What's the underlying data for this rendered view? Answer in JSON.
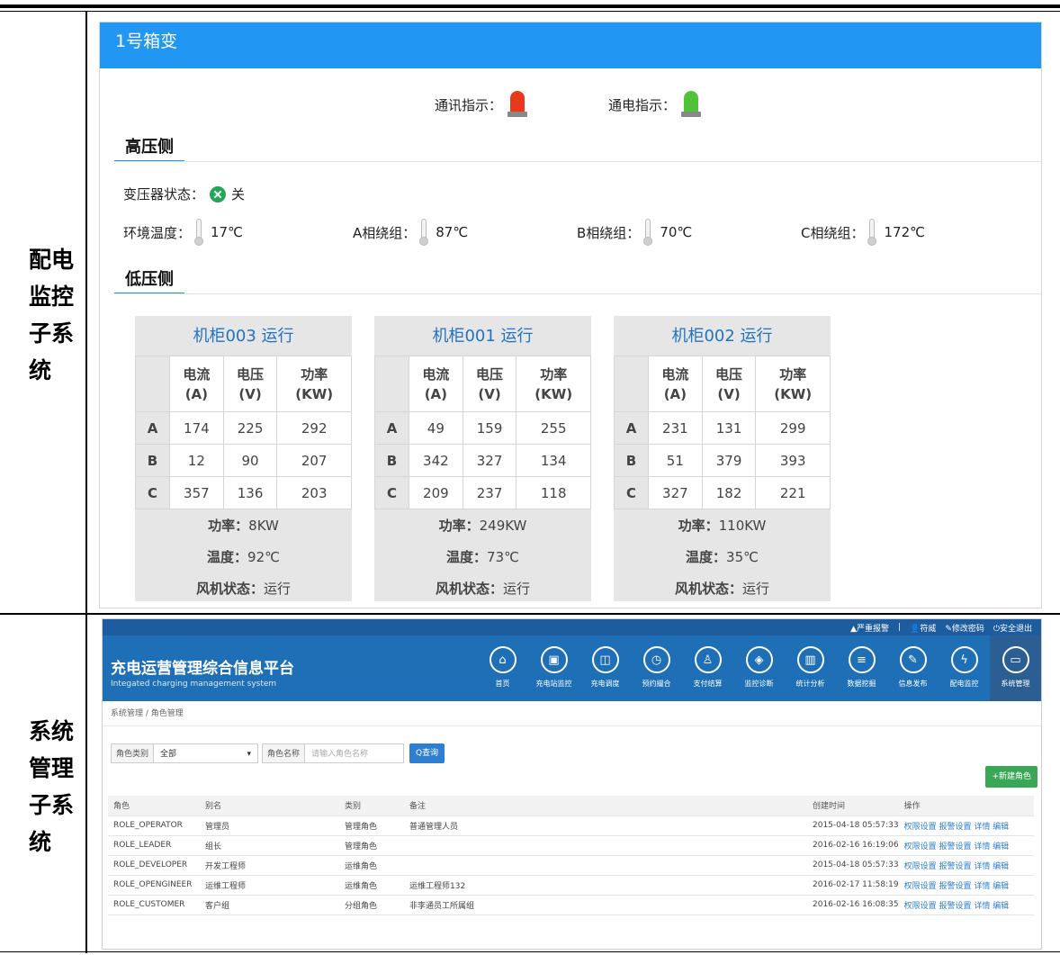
{
  "rows": [
    {
      "label": "配电监控子系统"
    },
    {
      "label": "系统管理子系统"
    }
  ],
  "monitor": {
    "title": "1号箱变",
    "comm_label": "通讯指示：",
    "power_label": "通电指示：",
    "high_side": "高压侧",
    "low_side": "低压侧",
    "transformer_label": "变压器状态：",
    "transformer_state": "关",
    "env_temp_label": "环境温度：",
    "env_temp": "17℃",
    "a_label": "A相绕组：",
    "a_temp": "87℃",
    "b_label": "B相绕组：",
    "b_temp": "70℃",
    "c_label": "C相绕组：",
    "c_temp": "172℃",
    "col_current": "电流",
    "col_current_unit": "(A)",
    "col_voltage": "电压",
    "col_voltage_unit": "(V)",
    "col_power": "功率",
    "col_power_unit": "(KW)",
    "power_prefix": "功率：",
    "temp_prefix": "温度：",
    "fan_prefix": "风机状态：",
    "colors": {
      "header": "#2196f3",
      "comm_lamp": "#e8391c",
      "power_lamp": "#4fc23a"
    },
    "cabinets": [
      {
        "name": "机柜003",
        "state": "运行",
        "rows": [
          [
            "A",
            "174",
            "225",
            "292"
          ],
          [
            "B",
            "12",
            "90",
            "207"
          ],
          [
            "C",
            "357",
            "136",
            "203"
          ]
        ],
        "power": "8KW",
        "temp": "92℃",
        "fan": "运行"
      },
      {
        "name": "机柜001",
        "state": "运行",
        "rows": [
          [
            "A",
            "49",
            "159",
            "255"
          ],
          [
            "B",
            "342",
            "327",
            "134"
          ],
          [
            "C",
            "209",
            "237",
            "118"
          ]
        ],
        "power": "249KW",
        "temp": "73℃",
        "fan": "运行"
      },
      {
        "name": "机柜002",
        "state": "运行",
        "rows": [
          [
            "A",
            "231",
            "131",
            "299"
          ],
          [
            "B",
            "51",
            "379",
            "393"
          ],
          [
            "C",
            "327",
            "182",
            "221"
          ]
        ],
        "power": "110KW",
        "temp": "35℃",
        "fan": "运行"
      }
    ]
  },
  "admin": {
    "topbar": [
      "▲严重报警",
      "|",
      "👤符威",
      "✎修改密码",
      "⏻安全退出"
    ],
    "brand_title": "充电运营管理综合信息平台",
    "brand_sub": "Integated charging management system",
    "nav": [
      {
        "icon": "⌂",
        "label": "首页",
        "icon_name": "home-icon"
      },
      {
        "icon": "▣",
        "label": "充电站监控",
        "icon_name": "station-icon"
      },
      {
        "icon": "◫",
        "label": "充电调度",
        "icon_name": "dispatch-icon"
      },
      {
        "icon": "◷",
        "label": "预约撮合",
        "icon_name": "clock-icon"
      },
      {
        "icon": "♙",
        "label": "支付结算",
        "icon_name": "money-icon"
      },
      {
        "icon": "◈",
        "label": "监控诊断",
        "icon_name": "diagnose-icon"
      },
      {
        "icon": "▥",
        "label": "统计分析",
        "icon_name": "chart-icon"
      },
      {
        "icon": "≡",
        "label": "数据挖掘",
        "icon_name": "list-icon"
      },
      {
        "icon": "✎",
        "label": "信息发布",
        "icon_name": "edit-icon"
      },
      {
        "icon": "ϟ",
        "label": "配电监控",
        "icon_name": "bolt-icon"
      },
      {
        "icon": "▭",
        "label": "系统管理",
        "icon_name": "monitor-icon"
      }
    ],
    "breadcrumb": "系统管理 / 角色管理",
    "filter_type_label": "角色类别",
    "filter_type_value": "全部",
    "filter_name_label": "角色名称",
    "filter_name_placeholder": "请输入角色名称",
    "search_btn": "Q查询",
    "new_btn": "+新建角色",
    "columns": [
      "角色",
      "别名",
      "类别",
      "备注",
      "创建时间",
      "操作"
    ],
    "rows": [
      [
        "ROLE_OPERATOR",
        "管理员",
        "管理角色",
        "普通管理人员",
        "2015-04-18 05:57:33",
        "权限设置 报警设置 详情 编辑"
      ],
      [
        "ROLE_LEADER",
        "组长",
        "管理角色",
        "",
        "2016-02-16 16:19:06",
        "权限设置 报警设置 详情 编辑"
      ],
      [
        "ROLE_DEVELOPER",
        "开发工程师",
        "运维角色",
        "",
        "2015-04-18 05:57:33",
        "权限设置 报警设置 详情 编辑"
      ],
      [
        "ROLE_OPENGINEER",
        "运维工程师",
        "运维角色",
        "运维工程师132",
        "2016-02-17 11:58:19",
        "权限设置 报警设置 详情 编辑"
      ],
      [
        "ROLE_CUSTOMER",
        "客户组",
        "分组角色",
        "非李通员工所属组",
        "2016-02-16 16:08:35",
        "权限设置 报警设置 详情 编辑"
      ]
    ]
  }
}
